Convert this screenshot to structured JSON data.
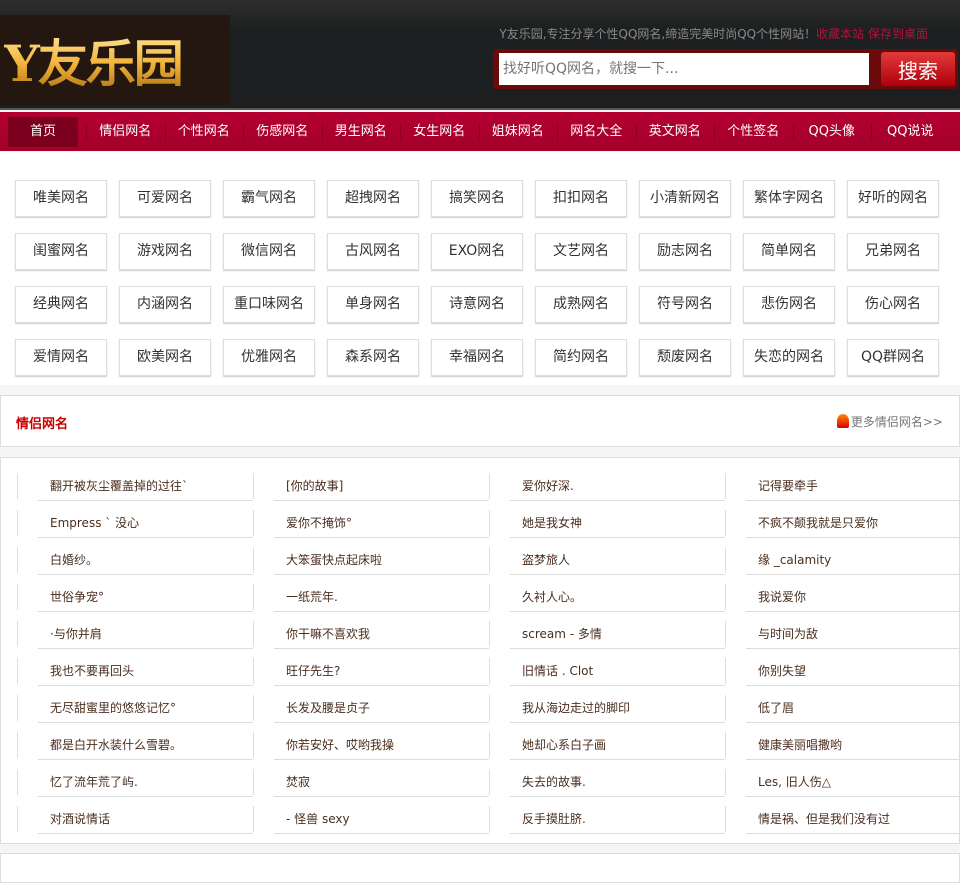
{
  "header": {
    "logo_text": "Y友乐园",
    "slogan": "Y友乐园,专注分享个性QQ网名,缔造完美时尚QQ个性网站！",
    "bookmark": "收藏本站",
    "save_desktop": "保存到桌面",
    "search_placeholder": "找好听QQ网名，就搜一下...",
    "search_button": "搜索"
  },
  "nav": [
    "首页",
    "情侣网名",
    "个性网名",
    "伤感网名",
    "男生网名",
    "女生网名",
    "姐妹网名",
    "网名大全",
    "英文网名",
    "个性签名",
    "QQ头像",
    "QQ说说"
  ],
  "tags": [
    [
      "唯美网名",
      "可爱网名",
      "霸气网名",
      "超拽网名",
      "搞笑网名",
      "扣扣网名",
      "小清新网名",
      "繁体字网名",
      "好听的网名"
    ],
    [
      "闺蜜网名",
      "游戏网名",
      "微信网名",
      "古风网名",
      "EXO网名",
      "文艺网名",
      "励志网名",
      "简单网名",
      "兄弟网名"
    ],
    [
      "经典网名",
      "内涵网名",
      "重口味网名",
      "单身网名",
      "诗意网名",
      "成熟网名",
      "符号网名",
      "悲伤网名",
      "伤心网名"
    ],
    [
      "爱情网名",
      "欧美网名",
      "优雅网名",
      "森系网名",
      "幸福网名",
      "简约网名",
      "颓废网名",
      "失恋的网名",
      "QQ群网名"
    ]
  ],
  "section": {
    "title": "情侣网名",
    "more": "更多情侣网名>>",
    "more_icon": "hot-flame-icon",
    "rows": [
      [
        "翻开被灰尘覆盖掉的过往`",
        "[你的故事]",
        "爱你好深.",
        "记得要牵手"
      ],
      [
        "Empress ` 没心",
        "爱你不掩饰°",
        "她是我女神",
        "不疯不颠我就是只爱你"
      ],
      [
        "白婚纱。",
        "大笨蛋快点起床啦",
        "盗梦旅人",
        "缘 _calamity"
      ],
      [
        "世俗争宠°",
        "一纸荒年.",
        "久衬人心。",
        "我说爱你"
      ],
      [
        "·与你并肩",
        "你干嘛不喜欢我",
        "scream - 多情",
        "与时间为敌"
      ],
      [
        "我也不要再回头",
        "旺仔先生?",
        "旧情话 . Clot",
        "你别失望"
      ],
      [
        "无尽甜蜜里的悠悠记忆°",
        "长发及腰是贞子",
        "我从海边走过的脚印",
        "低了眉"
      ],
      [
        "都是白开水装什么雪碧。",
        "你若安好、哎哟我操",
        "她却心系白子画",
        "健康美丽唱撒哟"
      ],
      [
        "忆了流年荒了屿.",
        "焚寂",
        "失去的故事.",
        "Les,   旧人伤△"
      ],
      [
        "对酒说情话",
        "- 怪兽 sexy",
        "反手摸肚脐.",
        "情是祸、但是我们没有过"
      ]
    ]
  }
}
